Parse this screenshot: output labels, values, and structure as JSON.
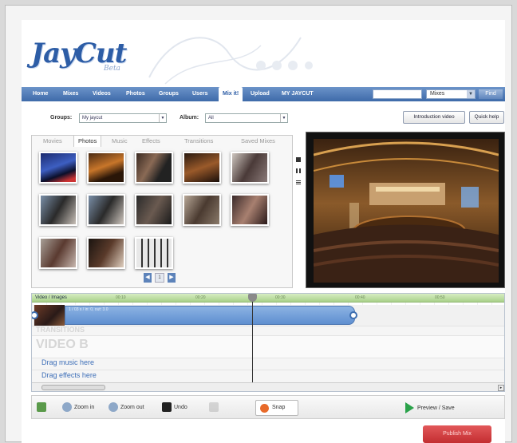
{
  "app": {
    "logo": "JayCut",
    "logo_sub": "Beta"
  },
  "nav": {
    "items": [
      "Home",
      "Mixes",
      "Videos",
      "Photos",
      "Groups",
      "Users",
      "Mix it!",
      "Upload",
      "MY JAYCUT"
    ],
    "active_item": "Mix it!",
    "search_value": "",
    "search_type": "Mixes",
    "find_label": "Find"
  },
  "filters": {
    "groups_label": "Groups:",
    "groups_value": "My jaycut",
    "album_label": "Album:",
    "album_value": "All",
    "intro_video_label": "Introduction video",
    "quick_help_label": "Quick help"
  },
  "media": {
    "tabs": [
      "Movies",
      "Photos",
      "Music",
      "Effects",
      "Transitions",
      "Saved Mixes"
    ],
    "active_tab": "Photos",
    "page_number": "1",
    "thumbnails": [
      {
        "kind": "stage-blue"
      },
      {
        "kind": "stage-orange"
      },
      {
        "kind": "person-selfie"
      },
      {
        "kind": "stage-dark"
      },
      {
        "kind": "person-dark"
      },
      {
        "kind": "woman-street"
      },
      {
        "kind": "woman-street"
      },
      {
        "kind": "group-night"
      },
      {
        "kind": "group-selfie"
      },
      {
        "kind": "group-night"
      },
      {
        "kind": "room-light"
      },
      {
        "kind": "room-dark"
      },
      {
        "kind": "device-keyboard"
      }
    ]
  },
  "timeline": {
    "header_label": "Video / Images",
    "ticks": [
      "00:10",
      "00:20",
      "00:30",
      "00:40",
      "00:50"
    ],
    "clip_info": "1 / 03 s / in: 0, out: 3.0",
    "transitions_label": "TRANSITIONS",
    "video_b_label": "VIDEO B",
    "drag_music": "Drag music here",
    "drag_effects": "Drag effects here"
  },
  "toolbar": {
    "zoom_in": "Zoom in",
    "zoom_out": "Zoom out",
    "undo": "Undo",
    "snap": "Snap",
    "preview_save": "Preview / Save"
  },
  "publish_label": "Publish Mix"
}
